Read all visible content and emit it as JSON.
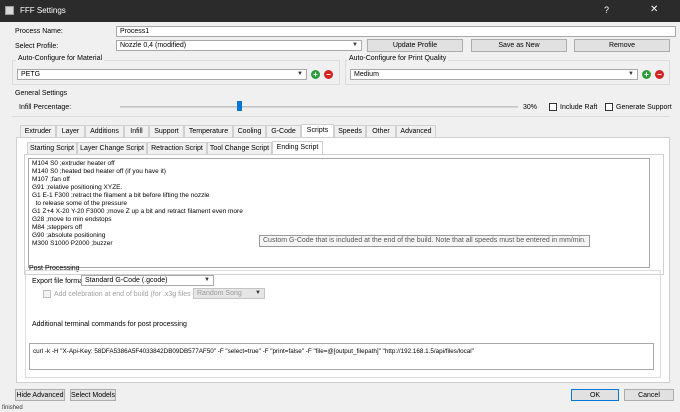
{
  "window": {
    "title": "FFF Settings",
    "help_label": "?",
    "close_label": "✕"
  },
  "process_name": {
    "label": "Process Name:",
    "value": "Process1"
  },
  "select_profile": {
    "label": "Select Profile:",
    "value": "Nozzle 0,4 (modified)",
    "update_label": "Update Profile",
    "save_as_new_label": "Save as New",
    "remove_label": "Remove"
  },
  "material": {
    "group_label": "Auto-Configure for Material",
    "value": "PETG"
  },
  "quality": {
    "group_label": "Auto-Configure for Print Quality",
    "value": "Medium"
  },
  "general": {
    "group_label": "General Settings",
    "infill_label": "Infill Percentage:",
    "infill_value": "30%",
    "infill_fraction": 0.3,
    "include_raft_label": "Include Raft",
    "generate_support_label": "Generate Support"
  },
  "tabs": [
    {
      "label": "Extruder"
    },
    {
      "label": "Layer"
    },
    {
      "label": "Additions"
    },
    {
      "label": "Infill"
    },
    {
      "label": "Support"
    },
    {
      "label": "Temperature"
    },
    {
      "label": "Cooling"
    },
    {
      "label": "G-Code"
    },
    {
      "label": "Scripts"
    },
    {
      "label": "Speeds"
    },
    {
      "label": "Other"
    },
    {
      "label": "Advanced"
    }
  ],
  "active_tab": "Scripts",
  "subtabs": [
    {
      "label": "Starting Script"
    },
    {
      "label": "Layer Change Script"
    },
    {
      "label": "Retraction Script"
    },
    {
      "label": "Tool Change Script"
    },
    {
      "label": "Ending Script"
    }
  ],
  "active_subtab": "Ending Script",
  "ending_script": {
    "lines": [
      "M104 S0 ;extruder heater off",
      "M140 S0 ;heated bed heater off (if you have it)",
      "M107 ;fan off",
      "G91 ;relative positioning XYZE.",
      "G1 E-1 F300 ;retract the filament a bit before lifting the nozzle",
      "  to release some of the pressure",
      "G1 Z+4 X-20 Y-20 F3000 ;move Z up a bit and retract filament even more",
      "G28 ;move to min endstops",
      "M84 ;steppers off",
      "G90 ;absolute positioning",
      "M300 S1000 P2000 ;buzzer"
    ],
    "tooltip": "Custom G-Code that is included at the end of the build.  Note that all speeds must be entered in mm/min."
  },
  "post_processing": {
    "group_label": "Post Processing",
    "export_format_label": "Export file format",
    "export_format_value": "Standard G-Code (.gcode)",
    "celebration_label": "Add celebration at end of build (for .x3g files only)",
    "celebration_value": "Random Song",
    "terminal_label": "Additional terminal commands for post processing",
    "terminal_value": "curl -k -H \"X-Api-Key: 58DFA5386A5F4033842DB09DB577AF50\" -F \"select=true\" -F \"print=false\" -F \"file=@[output_filepath]\" \"http://192.168.1.5/api/files/local\""
  },
  "footer": {
    "hide_advanced_label": "Hide Advanced",
    "select_models_label": "Select Models",
    "ok_label": "OK",
    "cancel_label": "Cancel"
  },
  "status_text": "finished"
}
